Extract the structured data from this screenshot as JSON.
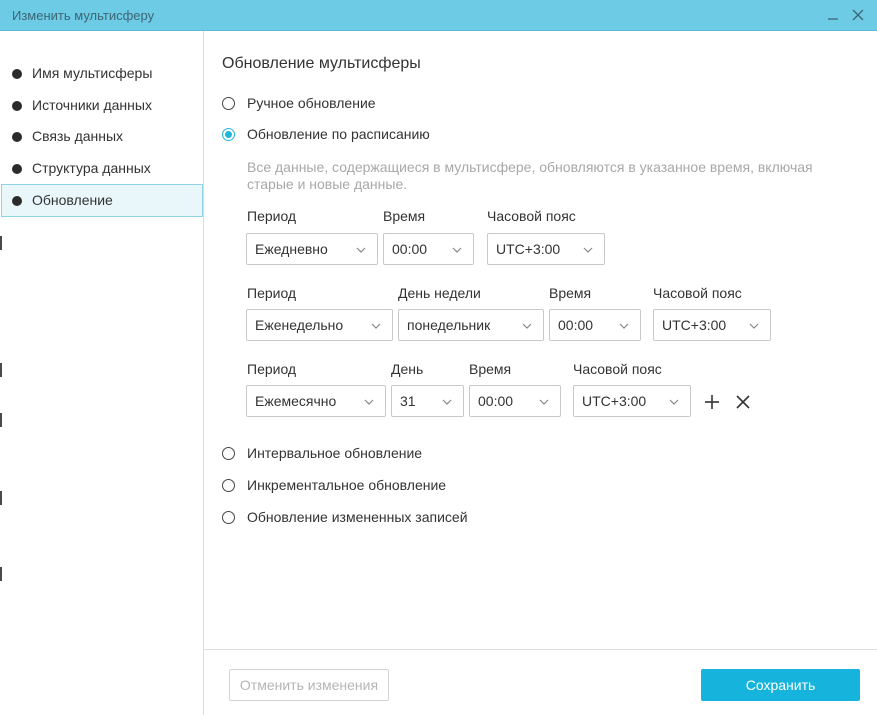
{
  "window": {
    "title": "Изменить мультисферу"
  },
  "sidebar": {
    "items": [
      {
        "label": "Имя мультисферы"
      },
      {
        "label": "Источники данных"
      },
      {
        "label": "Связь данных"
      },
      {
        "label": "Структура данных"
      },
      {
        "label": "Обновление",
        "active": true
      }
    ]
  },
  "main": {
    "heading": "Обновление мультисферы",
    "options": [
      {
        "label": "Ручное обновление",
        "checked": false
      },
      {
        "label": "Обновление по расписанию",
        "checked": true
      },
      {
        "label": "Интервальное обновление",
        "checked": false
      },
      {
        "label": "Инкрементальное обновление",
        "checked": false
      },
      {
        "label": "Обновление измененных записей",
        "checked": false
      }
    ],
    "description": "Все данные, содержащиеся в мультисфере, обновляются в указанное время, включая старые и новые данные.",
    "schedules": [
      {
        "period_label": "Период",
        "period": "Ежедневно",
        "time_label": "Время",
        "time": "00:00",
        "tz_label": "Часовой пояс",
        "tz": "UTC+3:00"
      },
      {
        "period_label": "Период",
        "period": "Еженедельно",
        "weekday_label": "День недели",
        "weekday": "понедельник",
        "time_label": "Время",
        "time": "00:00",
        "tz_label": "Часовой пояс",
        "tz": "UTC+3:00"
      },
      {
        "period_label": "Период",
        "period": "Ежемесячно",
        "day_label": "День",
        "day": "31",
        "time_label": "Время",
        "time": "00:00",
        "tz_label": "Часовой пояс",
        "tz": "UTC+3:00"
      }
    ]
  },
  "footer": {
    "cancel_label": "Отменить изменения",
    "save_label": "Сохранить"
  },
  "icons": {
    "minimize": "minimize-icon",
    "close": "close-icon",
    "chevron": "chevron-down-icon",
    "add": "plus-icon",
    "remove": "close-icon"
  },
  "colors": {
    "titlebar": "#6dcbe6",
    "accent": "#16b4dc",
    "active_nav_bg": "#e9f7fb",
    "active_nav_border": "#8fd3e6",
    "description_text": "#a8a8a8"
  }
}
